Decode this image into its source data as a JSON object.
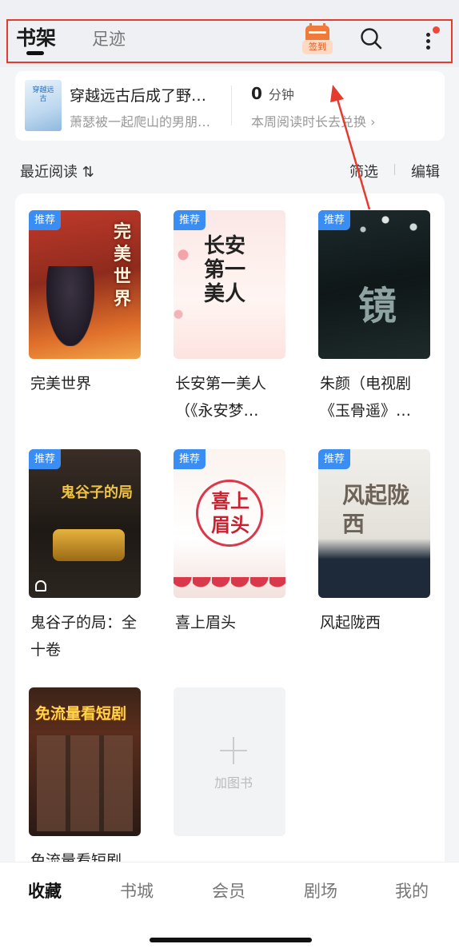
{
  "header": {
    "tab_active": "书架",
    "tab_other": "足迹",
    "signin_label": "签到",
    "icons": [
      "calendar-icon",
      "search-icon",
      "more-icon"
    ]
  },
  "recent_book": {
    "cover_text": "穿越远古",
    "title": "穿越远古后成了野…",
    "subtitle": "萧瑟被一起爬山的男朋…",
    "minutes_value": "0",
    "minutes_unit": "分钟",
    "weekly_text": "本周阅读时长去兑换"
  },
  "section": {
    "title": "最近阅读 ⇅",
    "filter": "筛选",
    "edit": "编辑"
  },
  "books": [
    {
      "title": "完美世界",
      "tag": "推荐",
      "cover_text": "完美世界"
    },
    {
      "title": "长安第一美人（《永安梦…",
      "tag": "推荐",
      "cover_text": "长安第一美人"
    },
    {
      "title": "朱颜（电视剧《玉骨遥》…",
      "tag": "推荐",
      "cover_text": "镜"
    },
    {
      "title": "鬼谷子的局：全十卷",
      "tag": "推荐",
      "cover_text": "鬼谷子的局"
    },
    {
      "title": "喜上眉头",
      "tag": "推荐",
      "cover_text": "喜上眉头"
    },
    {
      "title": "风起陇西",
      "tag": "推荐",
      "cover_text": "风起陇西"
    },
    {
      "title": "免流量看短剧",
      "tag": "",
      "cover_text": "免流量看短剧"
    }
  ],
  "add_book": "加图书",
  "bottom_nav": [
    "收藏",
    "书城",
    "会员",
    "剧场",
    "我的"
  ],
  "colors": {
    "accent_red": "#e53b2f",
    "tag_blue": "#3a8df3",
    "signin_orange": "#f07a3a"
  }
}
